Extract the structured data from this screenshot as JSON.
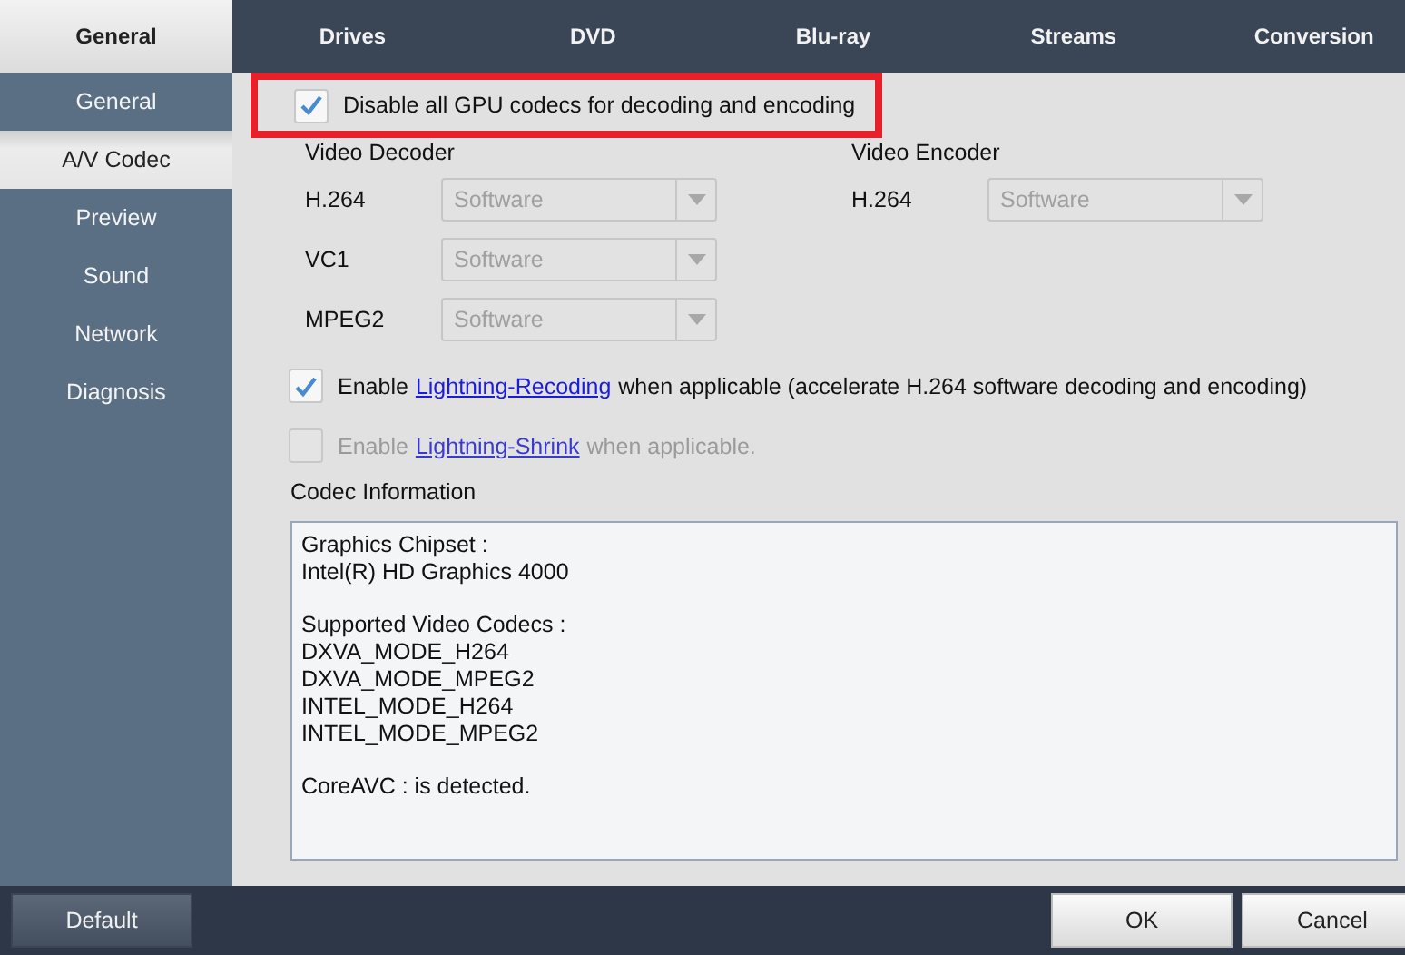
{
  "top_tabs": [
    {
      "label": "General",
      "selected": true
    },
    {
      "label": "Drives",
      "selected": false
    },
    {
      "label": "DVD",
      "selected": false
    },
    {
      "label": "Blu-ray",
      "selected": false
    },
    {
      "label": "Streams",
      "selected": false
    },
    {
      "label": "Conversion",
      "selected": false
    }
  ],
  "sidebar": {
    "items": [
      {
        "label": "General",
        "selected": false
      },
      {
        "label": "A/V Codec",
        "selected": true
      },
      {
        "label": "Preview",
        "selected": false
      },
      {
        "label": "Sound",
        "selected": false
      },
      {
        "label": "Network",
        "selected": false
      },
      {
        "label": "Diagnosis",
        "selected": false
      }
    ]
  },
  "disable_gpu": {
    "label": "Disable all GPU codecs for decoding and encoding",
    "checked": true,
    "highlighted": true
  },
  "decoder": {
    "title": "Video Decoder",
    "rows": [
      {
        "label": "H.264",
        "value": "Software",
        "disabled": true
      },
      {
        "label": "VC1",
        "value": "Software",
        "disabled": true
      },
      {
        "label": "MPEG2",
        "value": "Software",
        "disabled": true
      }
    ]
  },
  "encoder": {
    "title": "Video Encoder",
    "rows": [
      {
        "label": "H.264",
        "value": "Software",
        "disabled": true
      }
    ]
  },
  "options": [
    {
      "before": "Enable",
      "link": "Lightning-Recoding",
      "after": "when applicable (accelerate H.264 software decoding and encoding)",
      "checked": true,
      "disabled": false
    },
    {
      "before": "Enable",
      "link": "Lightning-Shrink",
      "after": "when applicable.",
      "checked": false,
      "disabled": true
    }
  ],
  "codec_info": {
    "title": "Codec Information",
    "groups": [
      [
        "Graphics Chipset :",
        "Intel(R) HD Graphics 4000"
      ],
      [
        "Supported Video Codecs :",
        "DXVA_MODE_H264",
        "DXVA_MODE_MPEG2",
        "INTEL_MODE_H264",
        "INTEL_MODE_MPEG2"
      ],
      [
        "CoreAVC : is detected."
      ]
    ]
  },
  "buttons": {
    "default": "Default",
    "ok": "OK",
    "cancel": "Cancel"
  }
}
